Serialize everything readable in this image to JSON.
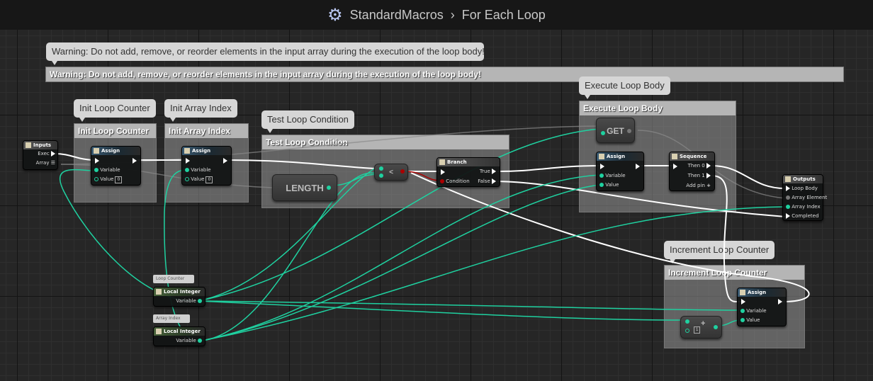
{
  "header": {
    "icon": "gear-icon",
    "breadcrumb": [
      "StandardMacros",
      "For Each Loop"
    ]
  },
  "comments": {
    "warning_bubble": "Warning: Do not add, remove, or reorder elements in the input array during the execution of the loop body!",
    "warning_box": "Warning: Do not add, remove, or reorder elements in the input array during the execution of the loop body!",
    "init_loop_counter": "Init Loop Counter",
    "init_array_index": "Init Array Index",
    "test_loop_condition": "Test Loop Condition",
    "execute_loop_body": "Execute Loop Body",
    "increment_loop_counter": "Increment Loop Counter"
  },
  "nodes": {
    "inputs": {
      "title": "Inputs",
      "exec": "Exec",
      "array": "Array"
    },
    "assign": {
      "title": "Assign",
      "variable": "Variable",
      "value": "Value",
      "default": "0"
    },
    "length": "LENGTH",
    "less": "<",
    "branch": {
      "title": "Branch",
      "condition": "Condition",
      "true": "True",
      "false": "False"
    },
    "get": "GET",
    "sequence": {
      "title": "Sequence",
      "then0": "Then 0",
      "then1": "Then 1",
      "add_pin": "Add pin"
    },
    "outputs": {
      "title": "Outputs",
      "loop_body": "Loop Body",
      "array_element": "Array Element",
      "array_index": "Array Index",
      "completed": "Completed"
    },
    "local_loop_counter": {
      "label": "Loop Counter",
      "title": "Local Integer",
      "variable": "Variable"
    },
    "local_array_index": {
      "label": "Array Index",
      "title": "Local Integer",
      "variable": "Variable"
    },
    "increment": {
      "default": "1",
      "op": "+"
    }
  },
  "colors": {
    "exec": "#ffffff",
    "integer": "#1fd1a0",
    "boolean": "#a00000",
    "wildcard": "#777777"
  }
}
